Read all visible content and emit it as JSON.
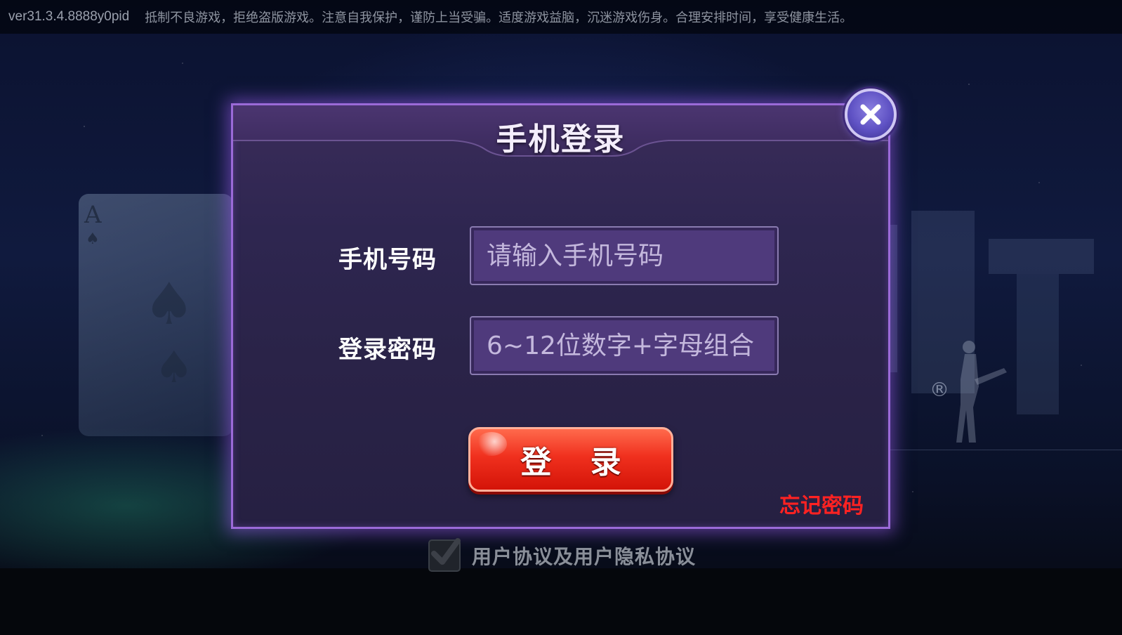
{
  "top_bar": {
    "version": "ver31.3.4.8888y0pid",
    "notice": "抵制不良游戏，拒绝盗版游戏。注意自我保护，谨防上当受骗。适度游戏益脑，沉迷游戏伤身。合理安排时间，享受健康生活。"
  },
  "background": {
    "card_rank": "A",
    "card_suit": "♠",
    "registered_mark": "®"
  },
  "dialog": {
    "title": "手机登录",
    "close_icon": "close-icon",
    "phone_label": "手机号码",
    "phone_placeholder": "请输入手机号码",
    "phone_value": "",
    "password_label": "登录密码",
    "password_placeholder": "6~12位数字+字母组合",
    "password_value": "",
    "login_label": "登 录",
    "forgot_label": "忘记密码"
  },
  "agreement": {
    "checked": true,
    "text": "用户协议及用户隐私协议"
  },
  "colors": {
    "dialog_border": "#9b6ad8",
    "input_bg": "#4f3a7c",
    "login_button": "#f0301e",
    "forgot_link": "#ff2222"
  }
}
